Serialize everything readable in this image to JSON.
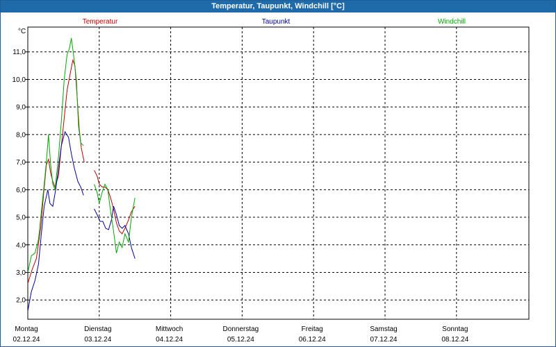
{
  "window": {
    "title": "Temperatur, Taupunkt, Windchill [°C]"
  },
  "chart_data": {
    "type": "line",
    "title": "Temperatur, Taupunkt, Windchill [°C]",
    "ylabel": "°C",
    "xlabel": "",
    "xlim": [
      0,
      7
    ],
    "ylim": [
      1.3,
      11.9
    ],
    "yticks": [
      2.0,
      3.0,
      4.0,
      5.0,
      6.0,
      7.0,
      8.0,
      9.0,
      10.0,
      11.0
    ],
    "ytick_labels": [
      "2,0",
      "3,0",
      "4,0",
      "5,0",
      "6,0",
      "7,0",
      "8,0",
      "9,0",
      "10,0",
      "11,0"
    ],
    "x_categories": [
      {
        "day": "Montag",
        "date": "02.12.24"
      },
      {
        "day": "Dienstag",
        "date": "03.12.24"
      },
      {
        "day": "Mittwoch",
        "date": "04.12.24"
      },
      {
        "day": "Donnerstag",
        "date": "05.12.24"
      },
      {
        "day": "Freitag",
        "date": "06.12.24"
      },
      {
        "day": "Samstag",
        "date": "07.12.24"
      },
      {
        "day": "Sonntag",
        "date": "08.12.24"
      }
    ],
    "grid": true,
    "legend_position": "top",
    "series": [
      {
        "name": "Temperatur",
        "color": "#c00000",
        "segments": [
          [
            [
              0.0,
              2.6
            ],
            [
              0.06,
              3.1
            ],
            [
              0.12,
              3.5
            ],
            [
              0.18,
              4.6
            ],
            [
              0.22,
              5.8
            ],
            [
              0.26,
              6.9
            ],
            [
              0.29,
              7.1
            ],
            [
              0.32,
              6.6
            ],
            [
              0.35,
              6.3
            ],
            [
              0.38,
              6.1
            ],
            [
              0.43,
              6.5
            ],
            [
              0.47,
              7.6
            ],
            [
              0.51,
              8.6
            ],
            [
              0.55,
              9.6
            ],
            [
              0.6,
              10.3
            ],
            [
              0.63,
              10.7
            ],
            [
              0.66,
              10.5
            ],
            [
              0.69,
              9.4
            ],
            [
              0.72,
              8.2
            ],
            [
              0.75,
              7.5
            ],
            [
              0.79,
              7.0
            ]
          ],
          [
            [
              0.93,
              6.7
            ],
            [
              0.97,
              6.5
            ],
            [
              1.0,
              6.2
            ],
            [
              1.04,
              6.1
            ],
            [
              1.08,
              6.1
            ],
            [
              1.12,
              6.0
            ],
            [
              1.16,
              5.7
            ],
            [
              1.2,
              5.3
            ],
            [
              1.24,
              4.8
            ],
            [
              1.28,
              4.5
            ],
            [
              1.32,
              4.4
            ],
            [
              1.36,
              4.6
            ],
            [
              1.41,
              4.9
            ],
            [
              1.45,
              5.2
            ],
            [
              1.5,
              5.4
            ]
          ]
        ]
      },
      {
        "name": "Taupunkt",
        "color": "#0000a0",
        "segments": [
          [
            [
              0.0,
              1.6
            ],
            [
              0.05,
              2.3
            ],
            [
              0.1,
              2.7
            ],
            [
              0.15,
              3.3
            ],
            [
              0.19,
              4.4
            ],
            [
              0.23,
              5.4
            ],
            [
              0.28,
              6.0
            ],
            [
              0.31,
              5.5
            ],
            [
              0.35,
              5.4
            ],
            [
              0.39,
              6.0
            ],
            [
              0.43,
              6.8
            ],
            [
              0.47,
              7.6
            ],
            [
              0.52,
              8.1
            ],
            [
              0.57,
              7.9
            ],
            [
              0.61,
              7.3
            ],
            [
              0.65,
              6.8
            ],
            [
              0.7,
              6.3
            ],
            [
              0.74,
              6.1
            ],
            [
              0.78,
              5.8
            ]
          ],
          [
            [
              0.93,
              5.3
            ],
            [
              0.97,
              5.1
            ],
            [
              1.01,
              4.85
            ],
            [
              1.05,
              4.85
            ],
            [
              1.09,
              4.6
            ],
            [
              1.13,
              4.55
            ],
            [
              1.17,
              4.9
            ],
            [
              1.2,
              5.4
            ],
            [
              1.24,
              5.1
            ],
            [
              1.28,
              4.7
            ],
            [
              1.32,
              4.6
            ],
            [
              1.36,
              4.7
            ],
            [
              1.41,
              4.4
            ],
            [
              1.45,
              3.9
            ],
            [
              1.5,
              3.5
            ]
          ]
        ]
      },
      {
        "name": "Windchill",
        "color": "#00a800",
        "segments": [
          [
            [
              0.0,
              3.0
            ],
            [
              0.05,
              3.6
            ],
            [
              0.1,
              3.7
            ],
            [
              0.15,
              4.2
            ],
            [
              0.19,
              5.2
            ],
            [
              0.23,
              6.2
            ],
            [
              0.26,
              7.0
            ],
            [
              0.29,
              8.0
            ],
            [
              0.32,
              6.9
            ],
            [
              0.35,
              6.2
            ],
            [
              0.38,
              6.0
            ],
            [
              0.43,
              7.2
            ],
            [
              0.47,
              8.5
            ],
            [
              0.51,
              10.0
            ],
            [
              0.55,
              10.9
            ],
            [
              0.58,
              11.1
            ],
            [
              0.61,
              11.5
            ],
            [
              0.64,
              10.9
            ],
            [
              0.68,
              10.0
            ],
            [
              0.71,
              8.3
            ],
            [
              0.74,
              7.7
            ],
            [
              0.78,
              7.6
            ]
          ],
          [
            [
              0.93,
              6.2
            ],
            [
              0.97,
              5.9
            ],
            [
              1.0,
              5.5
            ],
            [
              1.04,
              5.9
            ],
            [
              1.08,
              6.2
            ],
            [
              1.12,
              6.0
            ],
            [
              1.16,
              5.2
            ],
            [
              1.2,
              4.5
            ],
            [
              1.24,
              3.7
            ],
            [
              1.28,
              4.1
            ],
            [
              1.32,
              3.9
            ],
            [
              1.36,
              4.4
            ],
            [
              1.41,
              4.1
            ],
            [
              1.45,
              5.0
            ],
            [
              1.5,
              5.7
            ]
          ]
        ]
      }
    ]
  }
}
